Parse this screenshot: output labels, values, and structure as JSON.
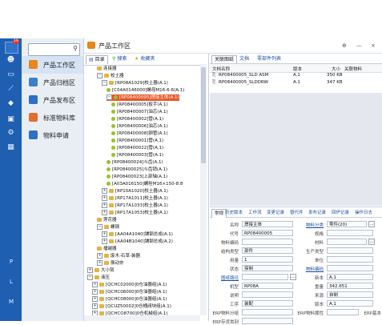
{
  "rail": {
    "badge": "19",
    "icons": [
      "user-icon",
      "monitor-icon",
      "chart-icon",
      "cube-icon",
      "gear-icon",
      "apps-icon",
      "blank-icon"
    ],
    "letters": [
      "P",
      "L",
      "M"
    ]
  },
  "modules": {
    "items": [
      {
        "label": "产品工作区",
        "color": "#e8861f",
        "icon": "workspace-icon"
      },
      {
        "label": "产品归档区",
        "color": "#3e7fc9",
        "icon": "archive-icon"
      },
      {
        "label": "产品发布区",
        "color": "#2f6fc4",
        "icon": "publish-icon"
      },
      {
        "label": "标准物料库",
        "color": "#e26d2c",
        "icon": "library-icon"
      },
      {
        "label": "物料申请",
        "color": "#2f6fc4",
        "icon": "request-icon"
      }
    ]
  },
  "titlebar": {
    "title": "产品工作区",
    "buttons": [
      "⊕",
      "—",
      "×"
    ]
  },
  "tree": {
    "tabs": [
      "目录",
      "搜索",
      "收藏夹"
    ],
    "rows": [
      {
        "indent": 4,
        "pm": "",
        "icon": "folder",
        "text": "连接器"
      },
      {
        "indent": 4,
        "pm": "−",
        "icon": "folder",
        "text": "校土器"
      },
      {
        "indent": 5,
        "pm": "−",
        "icon": "folder",
        "text": "[RP08A1029]校土器(A.1)"
      },
      {
        "indent": 6,
        "pm": "",
        "icon": "part",
        "text": "[C04A0146000]螺母M16-6-6(A.1)"
      },
      {
        "indent": 6,
        "pm": "−",
        "icon": "part",
        "text": "[RP08400095]焊接主体(A.1)",
        "hl": true
      },
      {
        "indent": 7,
        "pm": "",
        "icon": "part",
        "text": "[RP08400005]扳手(A.1)"
      },
      {
        "indent": 7,
        "pm": "",
        "icon": "part",
        "text": "[RP08400007]油芯(A.1)"
      },
      {
        "indent": 7,
        "pm": "",
        "icon": "part",
        "text": "[RP08400002]管(A.1)"
      },
      {
        "indent": 7,
        "pm": "",
        "icon": "part",
        "text": "[RP08400006]油芯(A.1)"
      },
      {
        "indent": 7,
        "pm": "",
        "icon": "part",
        "text": "[RP08400008]钢管(A.1)"
      },
      {
        "indent": 7,
        "pm": "",
        "icon": "part",
        "text": "[RP08400001]管(A.1)"
      },
      {
        "indent": 7,
        "pm": "",
        "icon": "part",
        "text": "[RP08400022]管(A.1)"
      },
      {
        "indent": 7,
        "pm": "",
        "icon": "part",
        "text": "[RP08400003]管(A.1)"
      },
      {
        "indent": 6,
        "pm": "",
        "icon": "part",
        "text": "[RP08400024]斗齿(A.1)"
      },
      {
        "indent": 6,
        "pm": "",
        "icon": "part",
        "text": "[RP08400025]斗齿销(A.1)"
      },
      {
        "indent": 6,
        "pm": "",
        "icon": "part",
        "text": "[RP08400023]上部轴(A.1)"
      },
      {
        "indent": 6,
        "pm": "",
        "icon": "part",
        "text": "[A03A016150]螺栓M16×150-8.8"
      },
      {
        "indent": 5,
        "pm": "+",
        "icon": "folder",
        "text": "[RP10A1020]校土器(A.1)"
      },
      {
        "indent": 5,
        "pm": "+",
        "icon": "folder",
        "text": "[RP17A1011]校土器(A.1)"
      },
      {
        "indent": 5,
        "pm": "+",
        "icon": "folder",
        "text": "[RP17A1033]校土器(A.1)"
      },
      {
        "indent": 5,
        "pm": "+",
        "icon": "folder",
        "text": "[RP17A1053]校土器(A.1)"
      },
      {
        "indent": 4,
        "pm": "",
        "icon": "folder",
        "text": "莲花器"
      },
      {
        "indent": 4,
        "pm": "−",
        "icon": "folder",
        "text": "螺钢"
      },
      {
        "indent": 5,
        "pm": "+",
        "icon": "folder",
        "text": "[AA04A1040]铺钢总成(A.1)"
      },
      {
        "indent": 5,
        "pm": "+",
        "icon": "folder",
        "text": "[AA04B1040]铺钢总成(A.2)"
      },
      {
        "indent": 4,
        "pm": "",
        "icon": "folder",
        "text": "播越器"
      },
      {
        "indent": 4,
        "pm": "+",
        "icon": "folder",
        "text": "废木-石草-装器"
      },
      {
        "indent": 4,
        "pm": "+",
        "icon": "folder",
        "text": "振动夯"
      },
      {
        "indent": 2,
        "pm": "+",
        "icon": "folder",
        "text": "大小臂"
      },
      {
        "indent": 2,
        "pm": "−",
        "icon": "folder",
        "text": "液压"
      },
      {
        "indent": 3,
        "pm": "+",
        "icon": "folder",
        "text": "[QCHC02000]0仓油器组(A.1)"
      },
      {
        "indent": 3,
        "pm": "+",
        "icon": "folder",
        "text": "[QCHC06000]0仓油器组(A.1)"
      },
      {
        "indent": 3,
        "pm": "+",
        "icon": "folder",
        "text": "[QCHC08000]0仓油器组(A.1)"
      },
      {
        "indent": 3,
        "pm": "+",
        "icon": "folder",
        "text": "[QCUZ50002]0仓桶阀块组(A.1)"
      },
      {
        "indent": 3,
        "pm": "+",
        "icon": "folder",
        "text": "[QCHCO8700]0仓机械组(A.1)"
      }
    ]
  },
  "docs": {
    "tabs": [
      "关联图纸",
      "文档",
      "零部件列表"
    ],
    "headers": [
      "文档名称",
      "版本",
      "大小",
      "关联物料"
    ],
    "rows": [
      {
        "name": "RP08400005_SLD ASM",
        "ver": "A.1",
        "size": "350 KB"
      },
      {
        "name": "RP08400005_SLDDRW",
        "ver": "A.1",
        "size": "347 KB"
      }
    ]
  },
  "props": {
    "tabs": [
      "常规",
      "历史版本",
      "工作流",
      "变更记录",
      "替代件",
      "发布记录",
      "回炉记录",
      "操作日志"
    ],
    "fields": [
      {
        "l1": "名称",
        "v1": "焊接主体",
        "l2": "物料分类",
        "v2": "零件(20)",
        "b2": "..."
      },
      {
        "l1": "代号",
        "v1": "RP08400005",
        "l2": "规格",
        "v2": ""
      },
      {
        "l1": "物料编码",
        "v1": "",
        "l2": "材料",
        "v2": "",
        "b2": "..."
      },
      {
        "l1": "结构类型",
        "v1": "部件",
        "l2": "生产类型",
        "v2": ""
      },
      {
        "l1": "用量",
        "v1": "1",
        "l2": "单位",
        "v2": ""
      },
      {
        "l1": "状态",
        "v1": "探制",
        "l2": "物料编码",
        "v2": ""
      },
      {
        "l1": "图纸路径",
        "v1": "",
        "l2": "新本",
        "v2": "A.1"
      },
      {
        "l1": "机型",
        "v1": "RP08A",
        "l2": "重量",
        "v2": "342.651"
      },
      {
        "l1": "说明",
        "v1": "",
        "l2": "来源",
        "v2": "自制"
      },
      {
        "l1": "工序",
        "v1": "装配",
        "l2": "版本",
        "v2": "A.1"
      },
      {
        "l1": "ERP物料分组",
        "v1": "",
        "l2": "ERP物料属性",
        "v2": "",
        "l3": "ERP基本"
      },
      {
        "l1": "ERP存货类别",
        "v1": "",
        "l2": "",
        "v2": ""
      }
    ]
  }
}
